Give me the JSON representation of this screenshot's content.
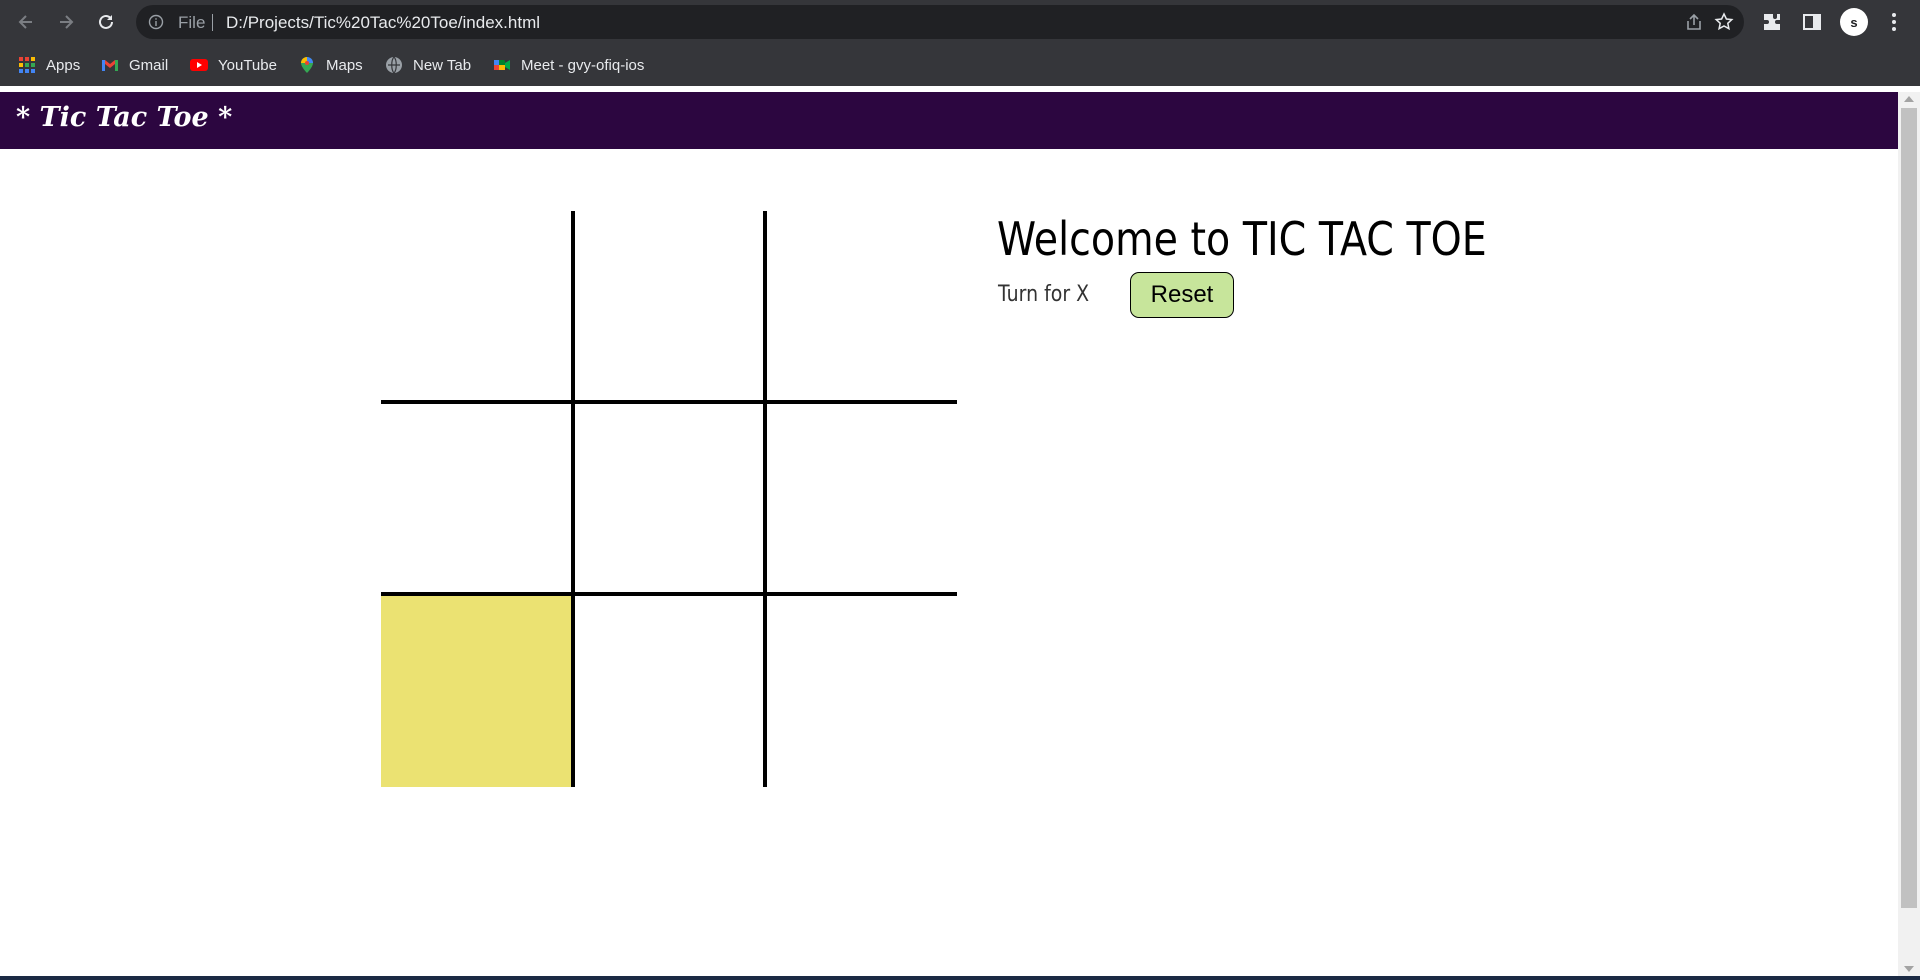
{
  "browser": {
    "url_scheme_label": "File",
    "url": "D:/Projects/Tic%20Tac%20Toe/index.html",
    "profile_initial": "s",
    "bookmarks": [
      {
        "label": "Apps",
        "icon": "apps-grid-icon"
      },
      {
        "label": "Gmail",
        "icon": "gmail-icon"
      },
      {
        "label": "YouTube",
        "icon": "youtube-icon"
      },
      {
        "label": "Maps",
        "icon": "maps-icon"
      },
      {
        "label": "New Tab",
        "icon": "globe-icon"
      },
      {
        "label": "Meet - gvy-ofiq-ios",
        "icon": "meet-icon"
      }
    ]
  },
  "page": {
    "header_title": "* Tic Tac Toe *",
    "welcome": "Welcome to TIC TAC TOE",
    "turn_text": "Turn for X",
    "reset_label": "Reset"
  },
  "game": {
    "cells": [
      "",
      "",
      "",
      "",
      "",
      "",
      "",
      "",
      ""
    ],
    "highlighted_cell": 6
  },
  "colors": {
    "header_bg": "#2c0640",
    "reset_bg": "#c7e59b",
    "highlight_cell": "#ebe272",
    "chrome_bg": "#35363a"
  }
}
